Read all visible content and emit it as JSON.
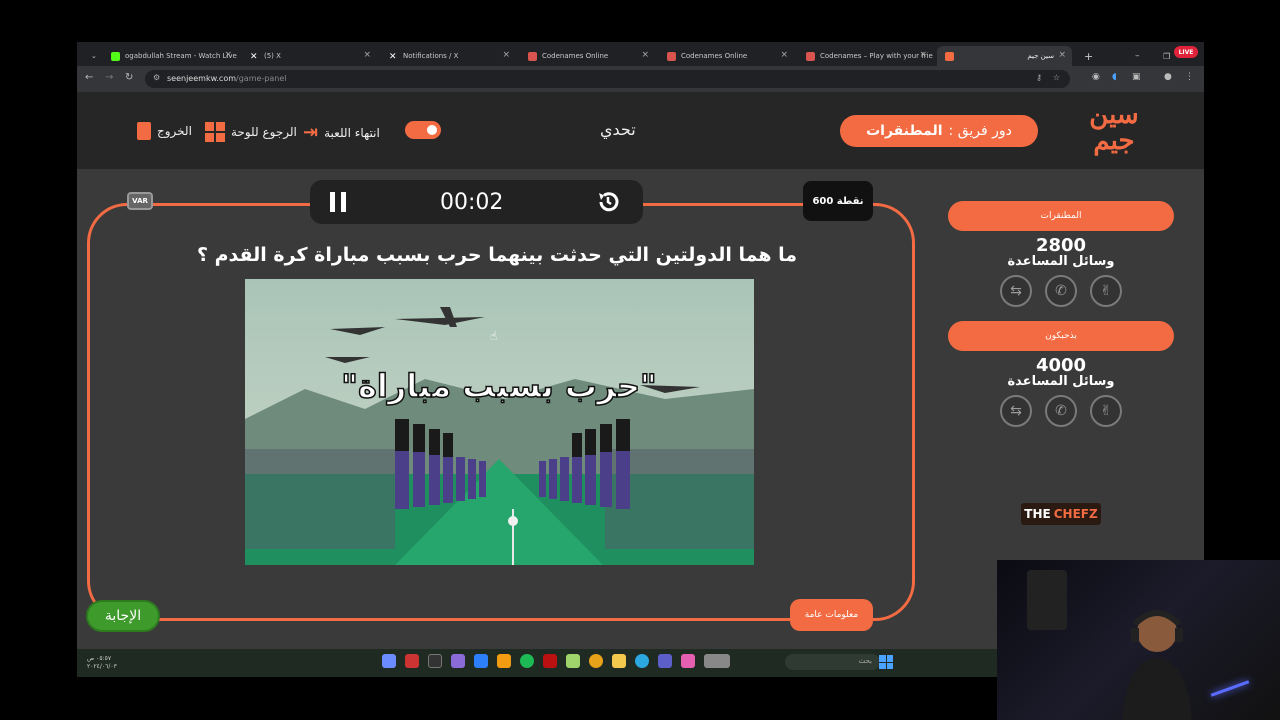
{
  "browser": {
    "tabs": [
      {
        "title": "ogabdullah Stream - Watch Live",
        "icon_color": "#53fc18"
      },
      {
        "title": "(5) X",
        "icon_color": "#ffffff"
      },
      {
        "title": "Notifications / X",
        "icon_color": "#ffffff"
      },
      {
        "title": "Codenames Online",
        "icon_color": "#d9534f"
      },
      {
        "title": "Codenames Online",
        "icon_color": "#d9534f"
      },
      {
        "title": "Codenames – Play with your frie",
        "icon_color": "#d9534f"
      },
      {
        "title": "سين جيم",
        "icon_color": "#f26b43"
      }
    ],
    "url_host": "seenjeemkw.com",
    "url_path": "/game-panel",
    "live_badge": "LIVE"
  },
  "header": {
    "exit_label": "الخروج",
    "back_label": "الرجوع للوحة",
    "end_game_label": "انتهاء اللعبة",
    "mode_label": "تحدي",
    "team_turn_prefix": "دور فريق :",
    "team_turn_name": "المطنقرات",
    "logo_text_top": "سين",
    "logo_text_bottom": "جيم"
  },
  "board": {
    "timer": "00:02",
    "points": "600 نقطة",
    "var_label": "VAR",
    "question": "ما هما الدولتين التي حدثت بينهما حرب بسبب مباراة كرة القدم ؟",
    "image_caption": "\"حرب بسبب مباراة\"",
    "answer_label": "الإجابة",
    "category_label": "معلومات عامة"
  },
  "teams": [
    {
      "name": "المطنقرات",
      "score": "2800",
      "aids_label": "وسائل المساعدة",
      "aids": [
        "swap-icon",
        "phone-icon",
        "two-answers-icon"
      ]
    },
    {
      "name": "بذحبكون",
      "score": "4000",
      "aids_label": "وسائل المساعدة",
      "aids": [
        "swap-icon",
        "phone-icon",
        "two-answers-icon"
      ]
    }
  ],
  "sponsor": {
    "text_a": "THE",
    "text_b": "CHEFZ"
  },
  "taskbar": {
    "time": "٠٥:٥٧ ص",
    "date": "٢٠٢٤/٠٦/٠٣",
    "search_placeholder": "بحث"
  },
  "colors": {
    "accent": "#f26b43",
    "answer_green": "#3f9a2c",
    "page_bg": "#3a3a3a"
  }
}
